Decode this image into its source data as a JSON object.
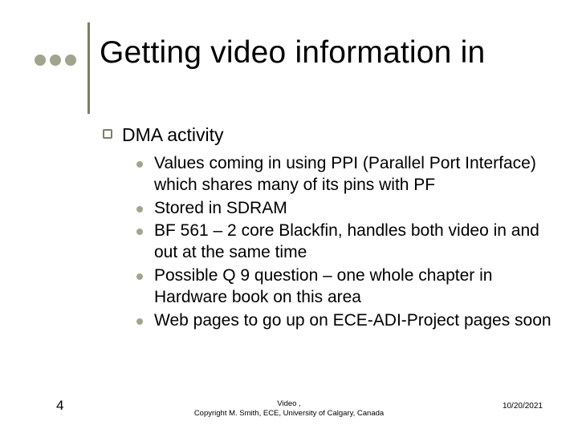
{
  "title": "Getting video information in",
  "level1": "DMA activity",
  "subitems": [
    "Values coming in using PPI (Parallel Port Interface) which shares many of its pins with PF",
    "Stored in SDRAM",
    "BF 561 – 2 core Blackfin, handles both video in and out at the same time",
    "Possible Q 9 question – one whole chapter in Hardware book on this area",
    "Web pages to go up on ECE-ADI-Project pages soon"
  ],
  "footer": {
    "page": "4",
    "center_line1": "Video                                      ,",
    "center_line2": "Copyright M. Smith, ECE, University of Calgary, Canada",
    "date": "10/20/2021"
  }
}
